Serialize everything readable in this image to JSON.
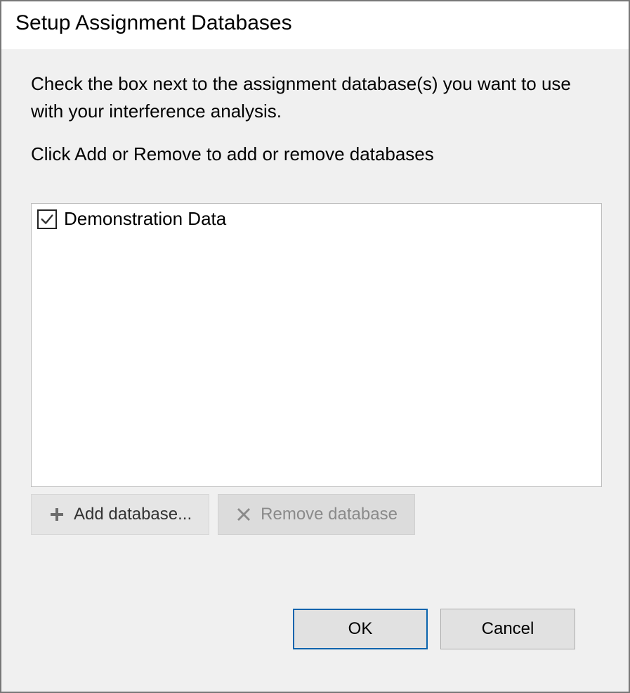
{
  "dialog": {
    "title": "Setup Assignment Databases",
    "instruction_line1": "Check the box next to the assignment database(s) you want to use with your interference analysis.",
    "instruction_line2": "Click Add or Remove to add or remove databases",
    "databases": [
      {
        "label": "Demonstration Data",
        "checked": true
      }
    ],
    "buttons": {
      "add_label": "Add database...",
      "remove_label": "Remove database",
      "ok_label": "OK",
      "cancel_label": "Cancel"
    }
  }
}
